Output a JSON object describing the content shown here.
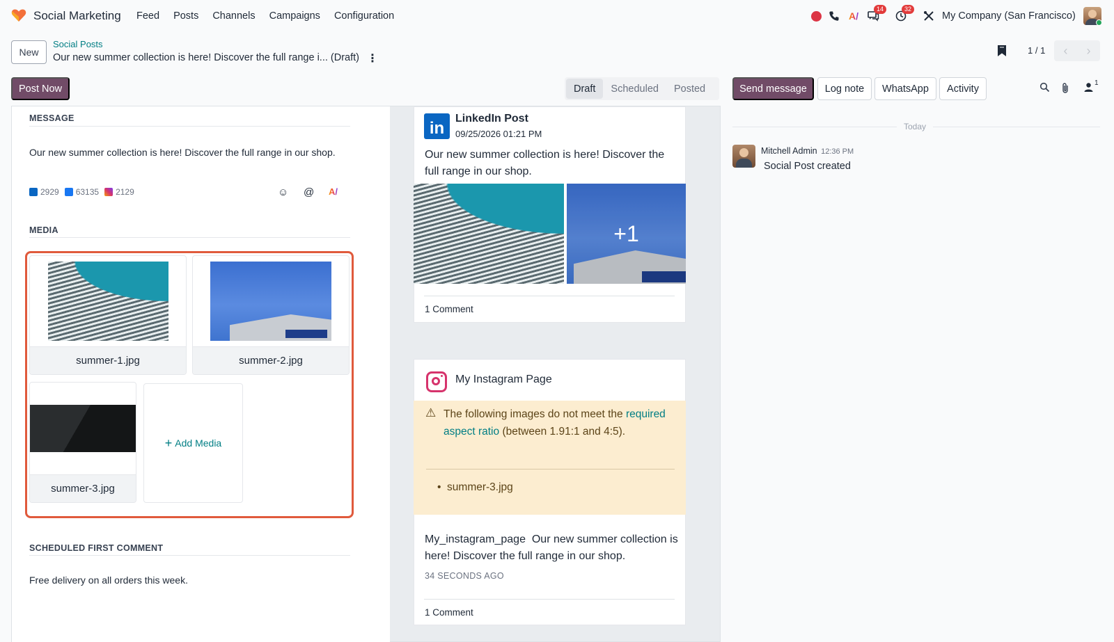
{
  "app": {
    "name": "Social Marketing"
  },
  "menu": [
    "Feed",
    "Posts",
    "Channels",
    "Campaigns",
    "Configuration"
  ],
  "systray": {
    "messages_badge": "14",
    "activities_badge": "32",
    "company": "My Company (San Francisco)"
  },
  "breadcrumb": {
    "new_label": "New",
    "parent": "Social Posts",
    "title": "Our new summer collection is here! Discover the full range i... (Draft)"
  },
  "pager": {
    "value": "1 / 1"
  },
  "actions": {
    "post_now": "Post Now"
  },
  "status": {
    "items": [
      "Draft",
      "Scheduled",
      "Posted"
    ],
    "active": "Draft"
  },
  "chatter_buttons": {
    "send": "Send message",
    "log": "Log note",
    "whatsapp": "WhatsApp",
    "activity": "Activity",
    "followers": "1"
  },
  "form": {
    "message_title": "MESSAGE",
    "message": "Our new summer collection is here! Discover the full range in our shop.",
    "counters": {
      "linkedin": "2929",
      "facebook": "63135",
      "instagram": "2129"
    },
    "media_title": "MEDIA",
    "media": [
      "summer-1.jpg",
      "summer-2.jpg",
      "summer-3.jpg"
    ],
    "add_media": "Add Media",
    "comment_title": "SCHEDULED FIRST COMMENT",
    "comment": "Free delivery on all orders this week."
  },
  "linkedin_preview": {
    "name": "LinkedIn Post",
    "date": "09/25/2026 01:21 PM",
    "text": "Our new summer collection is here! Discover the full range in our shop.",
    "more_images": "+1",
    "comments": "1 Comment"
  },
  "instagram_preview": {
    "name": "My Instagram Page",
    "warning_prefix": "The following images do not meet the",
    "warning_link": "required aspect ratio",
    "warning_suffix": "(between 1.91:1 and 4:5).",
    "warning_file": "summer-3.jpg",
    "account": "My_instagram_page",
    "text": "Our new summer collection is here! Discover the full range in our shop.",
    "ago": "34 SECONDS AGO",
    "comments": "1 Comment"
  },
  "chatter": {
    "today": "Today",
    "author": "Mitchell Admin",
    "time": "12:36 PM",
    "body": "Social Post created"
  },
  "colors": {
    "brand": "#714b67",
    "link": "#017e84",
    "highlight": "#e05a3c",
    "warning_bg": "#fcedd0"
  }
}
